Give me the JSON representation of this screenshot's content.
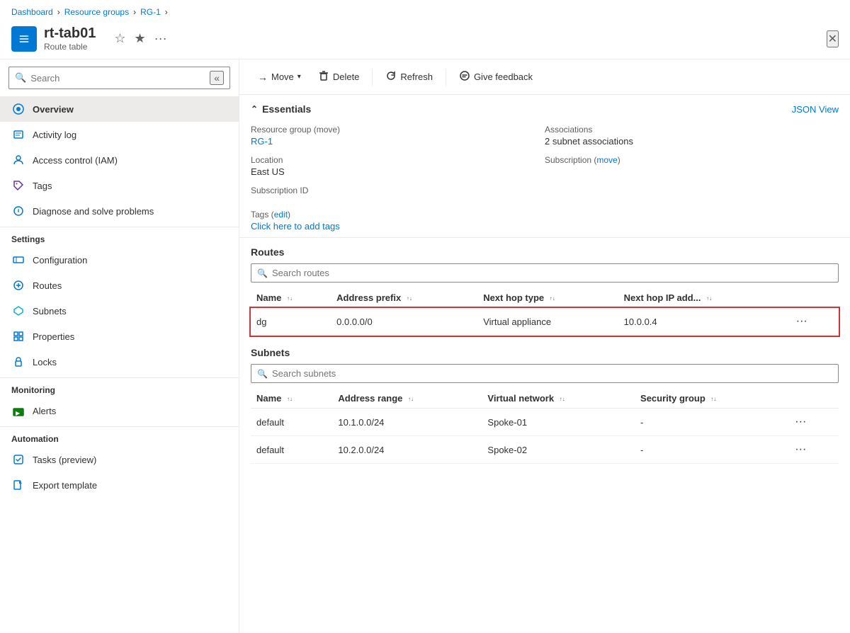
{
  "breadcrumb": {
    "items": [
      "Dashboard",
      "Resource groups",
      "RG-1"
    ]
  },
  "resource": {
    "name": "rt-tab01",
    "type": "Route table",
    "icon": "🗺"
  },
  "header_actions": {
    "favorite": "☆",
    "bookmark": "☆",
    "more": "...",
    "close": "✕"
  },
  "search": {
    "placeholder": "Search"
  },
  "toolbar": {
    "move_label": "Move",
    "delete_label": "Delete",
    "refresh_label": "Refresh",
    "feedback_label": "Give feedback"
  },
  "sidebar": {
    "nav_items": [
      {
        "id": "overview",
        "label": "Overview",
        "active": true
      },
      {
        "id": "activity-log",
        "label": "Activity log"
      },
      {
        "id": "access-control",
        "label": "Access control (IAM)"
      },
      {
        "id": "tags",
        "label": "Tags"
      },
      {
        "id": "diagnose",
        "label": "Diagnose and solve problems"
      }
    ],
    "settings_section": "Settings",
    "settings_items": [
      {
        "id": "configuration",
        "label": "Configuration"
      },
      {
        "id": "routes",
        "label": "Routes"
      },
      {
        "id": "subnets",
        "label": "Subnets"
      },
      {
        "id": "properties",
        "label": "Properties"
      },
      {
        "id": "locks",
        "label": "Locks"
      }
    ],
    "monitoring_section": "Monitoring",
    "monitoring_items": [
      {
        "id": "alerts",
        "label": "Alerts"
      }
    ],
    "automation_section": "Automation",
    "automation_items": [
      {
        "id": "tasks",
        "label": "Tasks (preview)"
      },
      {
        "id": "export-template",
        "label": "Export template"
      }
    ]
  },
  "essentials": {
    "title": "Essentials",
    "json_view": "JSON View",
    "resource_group_label": "Resource group (move)",
    "resource_group_value": "RG-1",
    "associations_label": "Associations",
    "associations_value": "2 subnet associations",
    "location_label": "Location",
    "location_value": "East US",
    "subscription_label": "Subscription (move)",
    "subscription_value": "",
    "subscription_id_label": "Subscription ID",
    "subscription_id_value": "",
    "tags_label": "Tags (edit)",
    "tags_link": "Click here to add tags"
  },
  "routes": {
    "section_title": "Routes",
    "search_placeholder": "Search routes",
    "columns": [
      "Name",
      "Address prefix",
      "Next hop type",
      "Next hop IP add..."
    ],
    "rows": [
      {
        "name": "dg",
        "address_prefix": "0.0.0.0/0",
        "next_hop_type": "Virtual appliance",
        "next_hop_ip": "10.0.0.4",
        "highlighted": true
      }
    ]
  },
  "subnets": {
    "section_title": "Subnets",
    "search_placeholder": "Search subnets",
    "columns": [
      "Name",
      "Address range",
      "Virtual network",
      "Security group"
    ],
    "rows": [
      {
        "name": "default",
        "address_range": "10.1.0.0/24",
        "virtual_network": "Spoke-01",
        "security_group": "-"
      },
      {
        "name": "default",
        "address_range": "10.2.0.0/24",
        "virtual_network": "Spoke-02",
        "security_group": "-"
      }
    ]
  }
}
